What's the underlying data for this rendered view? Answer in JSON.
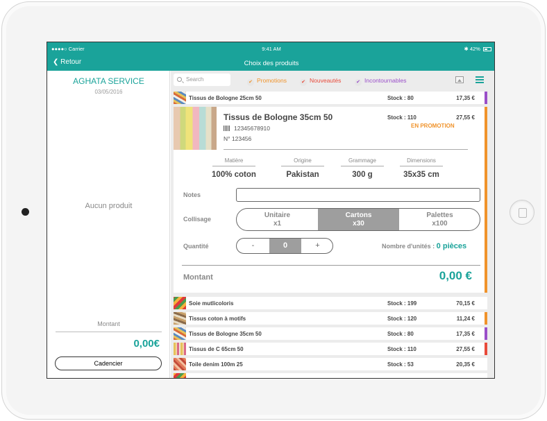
{
  "status": {
    "carrier": "●●●●○ Carrier",
    "time": "9:41 AM",
    "battery": "42%"
  },
  "nav": {
    "back": "Retour",
    "title": "Choix des produits"
  },
  "client": {
    "name": "AGHATA SERVICE",
    "date": "03/05/2016"
  },
  "cart": {
    "empty_text": "Aucun produit",
    "montant_label": "Montant",
    "montant_value": "0,00€",
    "cadencier": "Cadencier"
  },
  "search": {
    "placeholder": "Search"
  },
  "filters": [
    {
      "label": "Promotions",
      "color": "#f0932b"
    },
    {
      "label": "Nouveautés",
      "color": "#e84a3a"
    },
    {
      "label": "Incontournables",
      "color": "#9a4fc9"
    }
  ],
  "products": [
    {
      "name": "Tissus de Bologne 25cm 50",
      "stock": "Stock : 80",
      "price": "17,35 €",
      "bar": "#9a4fc9"
    },
    {
      "name": "Soie mutlicoloris",
      "stock": "Stock : 199",
      "price": "70,15 €",
      "bar": ""
    },
    {
      "name": "Tissus coton à motifs",
      "stock": "Stock : 120",
      "price": "11,24 €",
      "bar": "#f0932b"
    },
    {
      "name": "Tissus de Bologne 35cm 50",
      "stock": "Stock : 80",
      "price": "17,35 €",
      "bar": "#9a4fc9"
    },
    {
      "name": "Tissus de C 65cm 50",
      "stock": "Stock : 110",
      "price": "27,55 €",
      "bar": "#e84a3a"
    },
    {
      "name": "Toile denim 100m 25",
      "stock": "Stock : 53",
      "price": "20,35 €",
      "bar": ""
    }
  ],
  "detail": {
    "name": "Tissus de Bologne 35cm 50",
    "barcode": "12345678910",
    "number": "N° 123456",
    "stock": "Stock : 110",
    "price": "27,55 €",
    "promo": "EN PROMOTION",
    "accent": "#f0932b",
    "attributes": [
      {
        "label": "Matière",
        "value": "100% coton"
      },
      {
        "label": "Origine",
        "value": "Pakistan"
      },
      {
        "label": "Grammage",
        "value": "300 g"
      },
      {
        "label": "Dimensions",
        "value": "35x35 cm"
      }
    ],
    "notes_label": "Notes",
    "notes_value": "",
    "collisage_label": "Collisage",
    "collisage": [
      {
        "title": "Unitaire",
        "sub": "x1",
        "active": false
      },
      {
        "title": "Cartons",
        "sub": "x30",
        "active": true
      },
      {
        "title": "Palettes",
        "sub": "x100",
        "active": false
      }
    ],
    "quantite_label": "Quantité",
    "qty_minus": "-",
    "qty_value": "0",
    "qty_plus": "+",
    "units_label": "Nombre d'unités :",
    "units_value": "0 pièces",
    "montant_label": "Montant",
    "montant_value": "0,00 €"
  },
  "colors": {
    "accent": "#1aa39a"
  }
}
